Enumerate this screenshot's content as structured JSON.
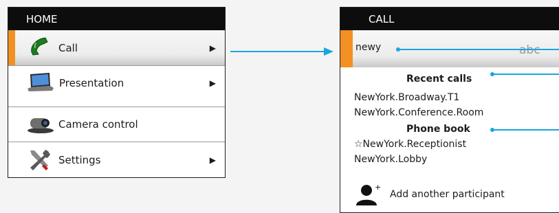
{
  "home": {
    "title": "HOME",
    "items": [
      {
        "label": "Call",
        "icon": "phone-icon",
        "arrow": "▶"
      },
      {
        "label": "Presentation",
        "icon": "laptop-icon",
        "arrow": "▶"
      },
      {
        "label": "Camera control",
        "icon": "camera-icon"
      },
      {
        "label": "Settings",
        "icon": "tools-icon",
        "arrow": "▶"
      }
    ]
  },
  "call": {
    "title": "CALL",
    "search_value": "newy",
    "keyboard_hint": "abc",
    "recent_heading": "Recent calls",
    "recent": [
      "NewYork.Broadway.T1",
      "NewYork.Conference.Room"
    ],
    "phonebook_heading": "Phone book",
    "phonebook": [
      "☆NewYork.Receptionist",
      "NewYork.Lobby"
    ],
    "add_participant": "Add another participant"
  },
  "colors": {
    "accent": "#f29023",
    "callout": "#1aa5e0",
    "header": "#0d0d0d"
  }
}
